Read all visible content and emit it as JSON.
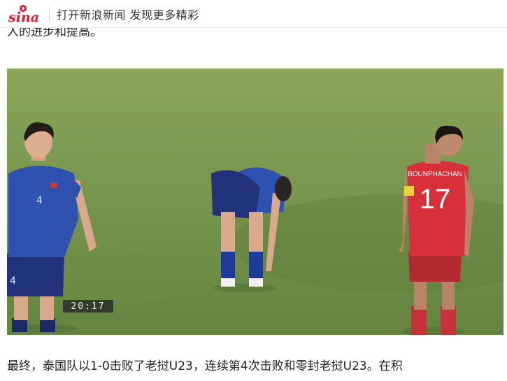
{
  "header": {
    "logo_text": "sina",
    "open_app_text": "打开新浪新闻 发现更多精彩"
  },
  "article": {
    "previous_line_fragment": "人的进步和提高。",
    "photo": {
      "match_clock": "20:17",
      "jersey_name": "BOUNPHACHAN",
      "jersey_number": "17",
      "jersey_number_blue": "4",
      "blue_team_color": "#2e4fae",
      "red_team_color": "#d6303b"
    },
    "caption_line": "最终，泰国队以1-0击败了老挝U23，连续第4次击败和零封老挝U23。在积"
  }
}
